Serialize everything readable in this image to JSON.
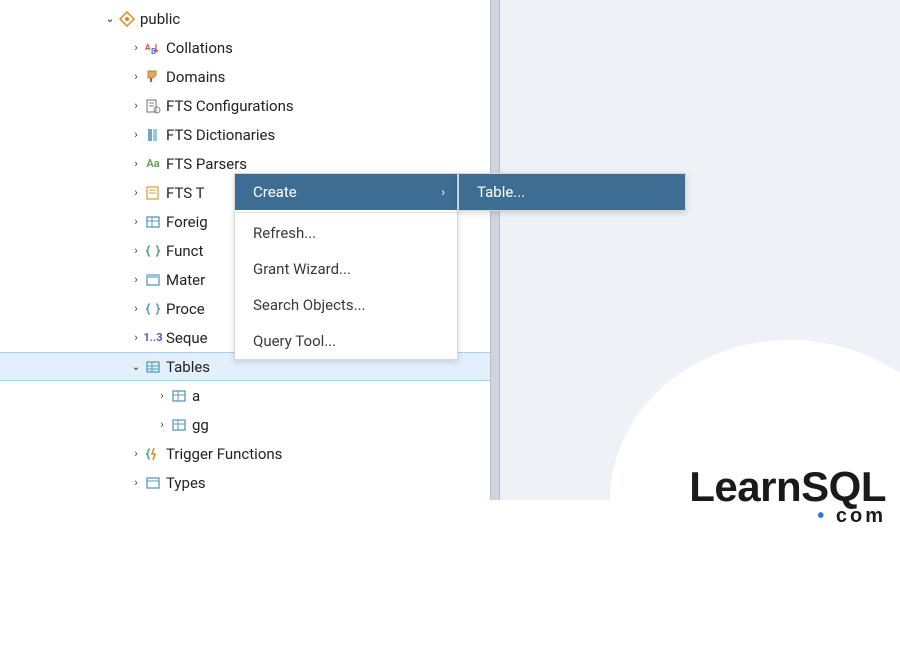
{
  "tree": {
    "schema_label": "public",
    "items": [
      "Collations",
      "Domains",
      "FTS Configurations",
      "FTS Dictionaries",
      "FTS Parsers",
      "FTS T",
      "Foreig",
      "Funct",
      "Mater",
      "Proce",
      "Seque",
      "Tables",
      "Trigger Functions",
      "Types"
    ],
    "tables_children": [
      "a",
      "gg"
    ]
  },
  "context_menu": {
    "create": "Create",
    "refresh": "Refresh...",
    "grant_wizard": "Grant Wizard...",
    "search_objects": "Search Objects...",
    "query_tool": "Query Tool..."
  },
  "submenu": {
    "table": "Table..."
  },
  "branding": {
    "learn": "Learn",
    "sql": "SQL",
    "dotcom": "com"
  },
  "colors": {
    "menu_highlight": "#3e6d94",
    "selection_bg": "#e3f0fb",
    "right_bg": "#eef1f6"
  }
}
